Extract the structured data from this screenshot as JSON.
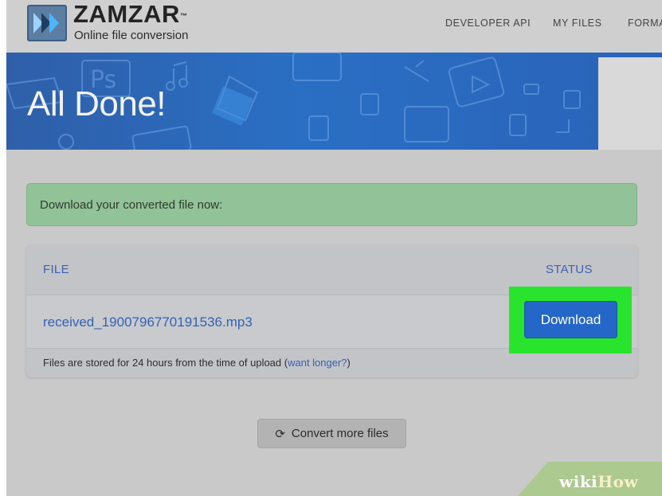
{
  "header": {
    "logo_name": "ZAMZAR",
    "logo_trademark": "™",
    "logo_tagline": "Online file conversion",
    "nav": [
      "DEVELOPER API",
      "MY FILES",
      "FORMA"
    ]
  },
  "banner": {
    "title": "All Done!"
  },
  "alert": {
    "text": "Download your converted file now:"
  },
  "table": {
    "columns": [
      "FILE",
      "STATUS"
    ],
    "rows": [
      {
        "file_name": "received_1900796770191536.mp3",
        "action_label": "Download"
      }
    ],
    "footer_text": "Files are stored for 24 hours from the time of upload (",
    "footer_link": "want longer?",
    "footer_close": ")"
  },
  "convert_more_label": "Convert more files",
  "icons": {
    "logo": "zamzar-logo-icon",
    "refresh": "refresh-icon"
  },
  "watermark": {
    "part1": "wiki",
    "part2": "How"
  },
  "colors": {
    "banner_blue": "#2a6fc4",
    "alert_green": "#92c297",
    "highlight_green": "#29e42c",
    "download_blue": "#2566c9",
    "link_blue": "#3561b3"
  }
}
